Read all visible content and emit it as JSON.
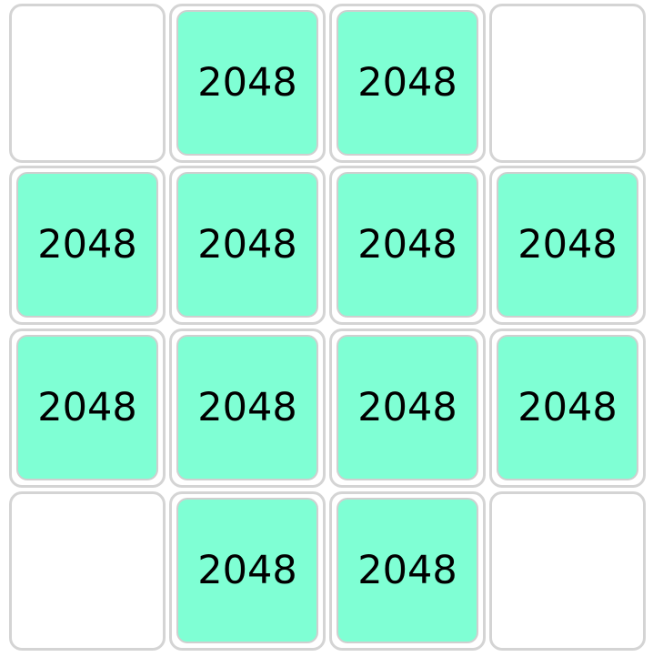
{
  "board": {
    "rows": 4,
    "cols": 4,
    "tile_color": "#7FFFD4",
    "cells": [
      [
        "",
        "2048",
        "2048",
        ""
      ],
      [
        "2048",
        "2048",
        "2048",
        "2048"
      ],
      [
        "2048",
        "2048",
        "2048",
        "2048"
      ],
      [
        "",
        "2048",
        "2048",
        ""
      ]
    ]
  }
}
